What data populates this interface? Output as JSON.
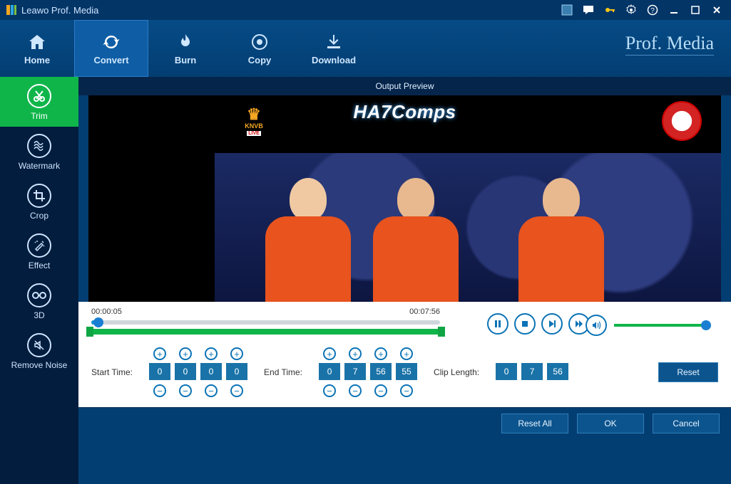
{
  "app": {
    "title": "Leawo Prof. Media",
    "brand": "Prof. Media"
  },
  "titlebar_icons": [
    "activity",
    "feedback",
    "key",
    "settings",
    "help",
    "minimize",
    "maximize",
    "close"
  ],
  "topnav": [
    {
      "id": "home",
      "label": "Home"
    },
    {
      "id": "convert",
      "label": "Convert"
    },
    {
      "id": "burn",
      "label": "Burn"
    },
    {
      "id": "copy",
      "label": "Copy"
    },
    {
      "id": "download",
      "label": "Download"
    }
  ],
  "topnav_active": "convert",
  "sidebar": [
    {
      "id": "trim",
      "label": "Trim"
    },
    {
      "id": "watermark",
      "label": "Watermark"
    },
    {
      "id": "crop",
      "label": "Crop"
    },
    {
      "id": "effect",
      "label": "Effect"
    },
    {
      "id": "3d",
      "label": "3D"
    },
    {
      "id": "remove-noise",
      "label": "Remove Noise"
    }
  ],
  "sidebar_active": "trim",
  "preview": {
    "header": "Output Preview",
    "overlay_text": "HA7Comps",
    "badge_knvb": "KNVB",
    "badge_knvb_live": "LIVE"
  },
  "timeline": {
    "current_time": "00:00:05",
    "total_time": "00:07:56"
  },
  "labels": {
    "start_time": "Start Time:",
    "end_time": "End Time:",
    "clip_length": "Clip Length:",
    "reset": "Reset",
    "reset_all": "Reset All",
    "ok": "OK",
    "cancel": "Cancel"
  },
  "start_time": [
    "0",
    "0",
    "0",
    "0"
  ],
  "end_time": [
    "0",
    "7",
    "56",
    "55"
  ],
  "clip_length": [
    "0",
    "7",
    "56"
  ]
}
